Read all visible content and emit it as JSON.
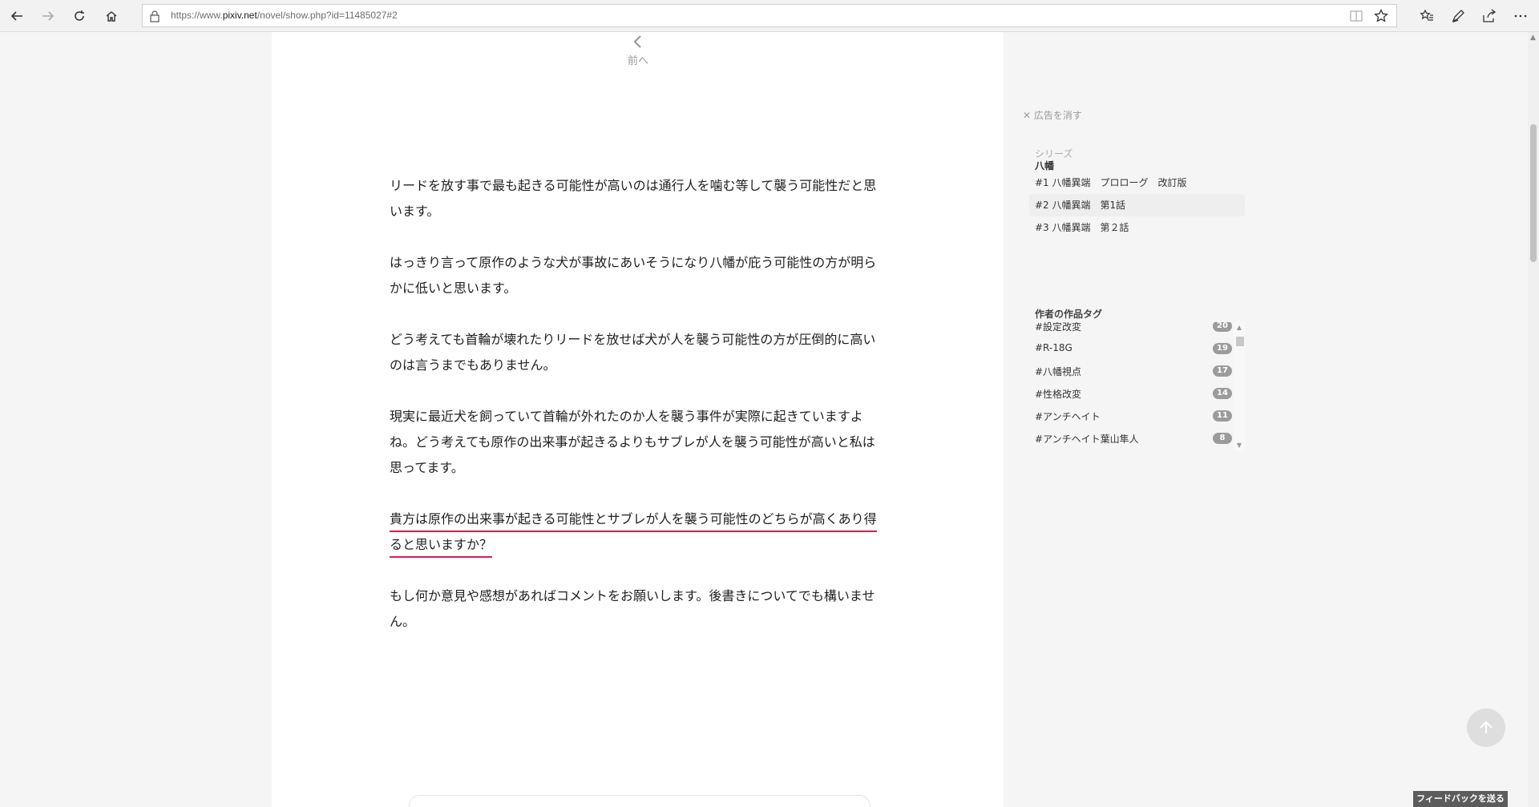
{
  "browser": {
    "url_prefix": "https://www.",
    "url_domain": "pixiv.net",
    "url_path": "/novel/show.php?id=11485027#2",
    "icons": [
      "back-icon",
      "forward-icon",
      "refresh-icon",
      "home-icon",
      "lock-icon",
      "reading-view-icon",
      "favorite-star-icon",
      "favorites-hub-icon",
      "pen-icon",
      "share-icon",
      "more-icon"
    ]
  },
  "nav": {
    "prev_label": "前へ"
  },
  "novel": {
    "paragraphs": [
      "リードを放す事で最も起きる可能性が高いのは通行人を噛む等して襲う可能性だと思います。",
      "はっきり言って原作のような犬が事故にあいそうになり八幡が庇う可能性の方が明らかに低いと思います。",
      "どう考えても首輪が壊れたりリードを放せば犬が人を襲う可能性の方が圧倒的に高いのは言うまでもありません。",
      "現実に最近犬を飼っていて首輪が外れたのか人を襲う事件が実際に起きていますよね。どう考えても原作の出来事が起きるよりもサブレが人を襲う可能性が高いと私は思ってます。",
      "貴方は原作の出来事が起きる可能性とサブレが人を襲う可能性のどちらが高くあり得ると思いますか？",
      "もし何か意見や感想があればコメントをお願いします。後書きについてでも構いません。"
    ],
    "highlight_color": "#d6204e"
  },
  "sidebar": {
    "hide_ad": "✕ 広告を消す",
    "series_label": "シリーズ",
    "series_name": "八幡",
    "series_items": [
      {
        "label": "#1 八幡異端　プロローグ　改訂版",
        "current": false
      },
      {
        "label": "#2 八幡異端　第1話",
        "current": true
      },
      {
        "label": "#3 八幡異端　第２話",
        "current": false
      }
    ],
    "tags_title": "作者の作品タグ",
    "tags": [
      {
        "name": "#設定改変",
        "count": "20"
      },
      {
        "name": "#R-18G",
        "count": "19"
      },
      {
        "name": "#八幡視点",
        "count": "17"
      },
      {
        "name": "#性格改変",
        "count": "14"
      },
      {
        "name": "#アンチヘイト",
        "count": "11"
      },
      {
        "name": "#アンチヘイト葉山隼人",
        "count": "8"
      }
    ]
  },
  "feedback_label": "フィードバックを送る"
}
